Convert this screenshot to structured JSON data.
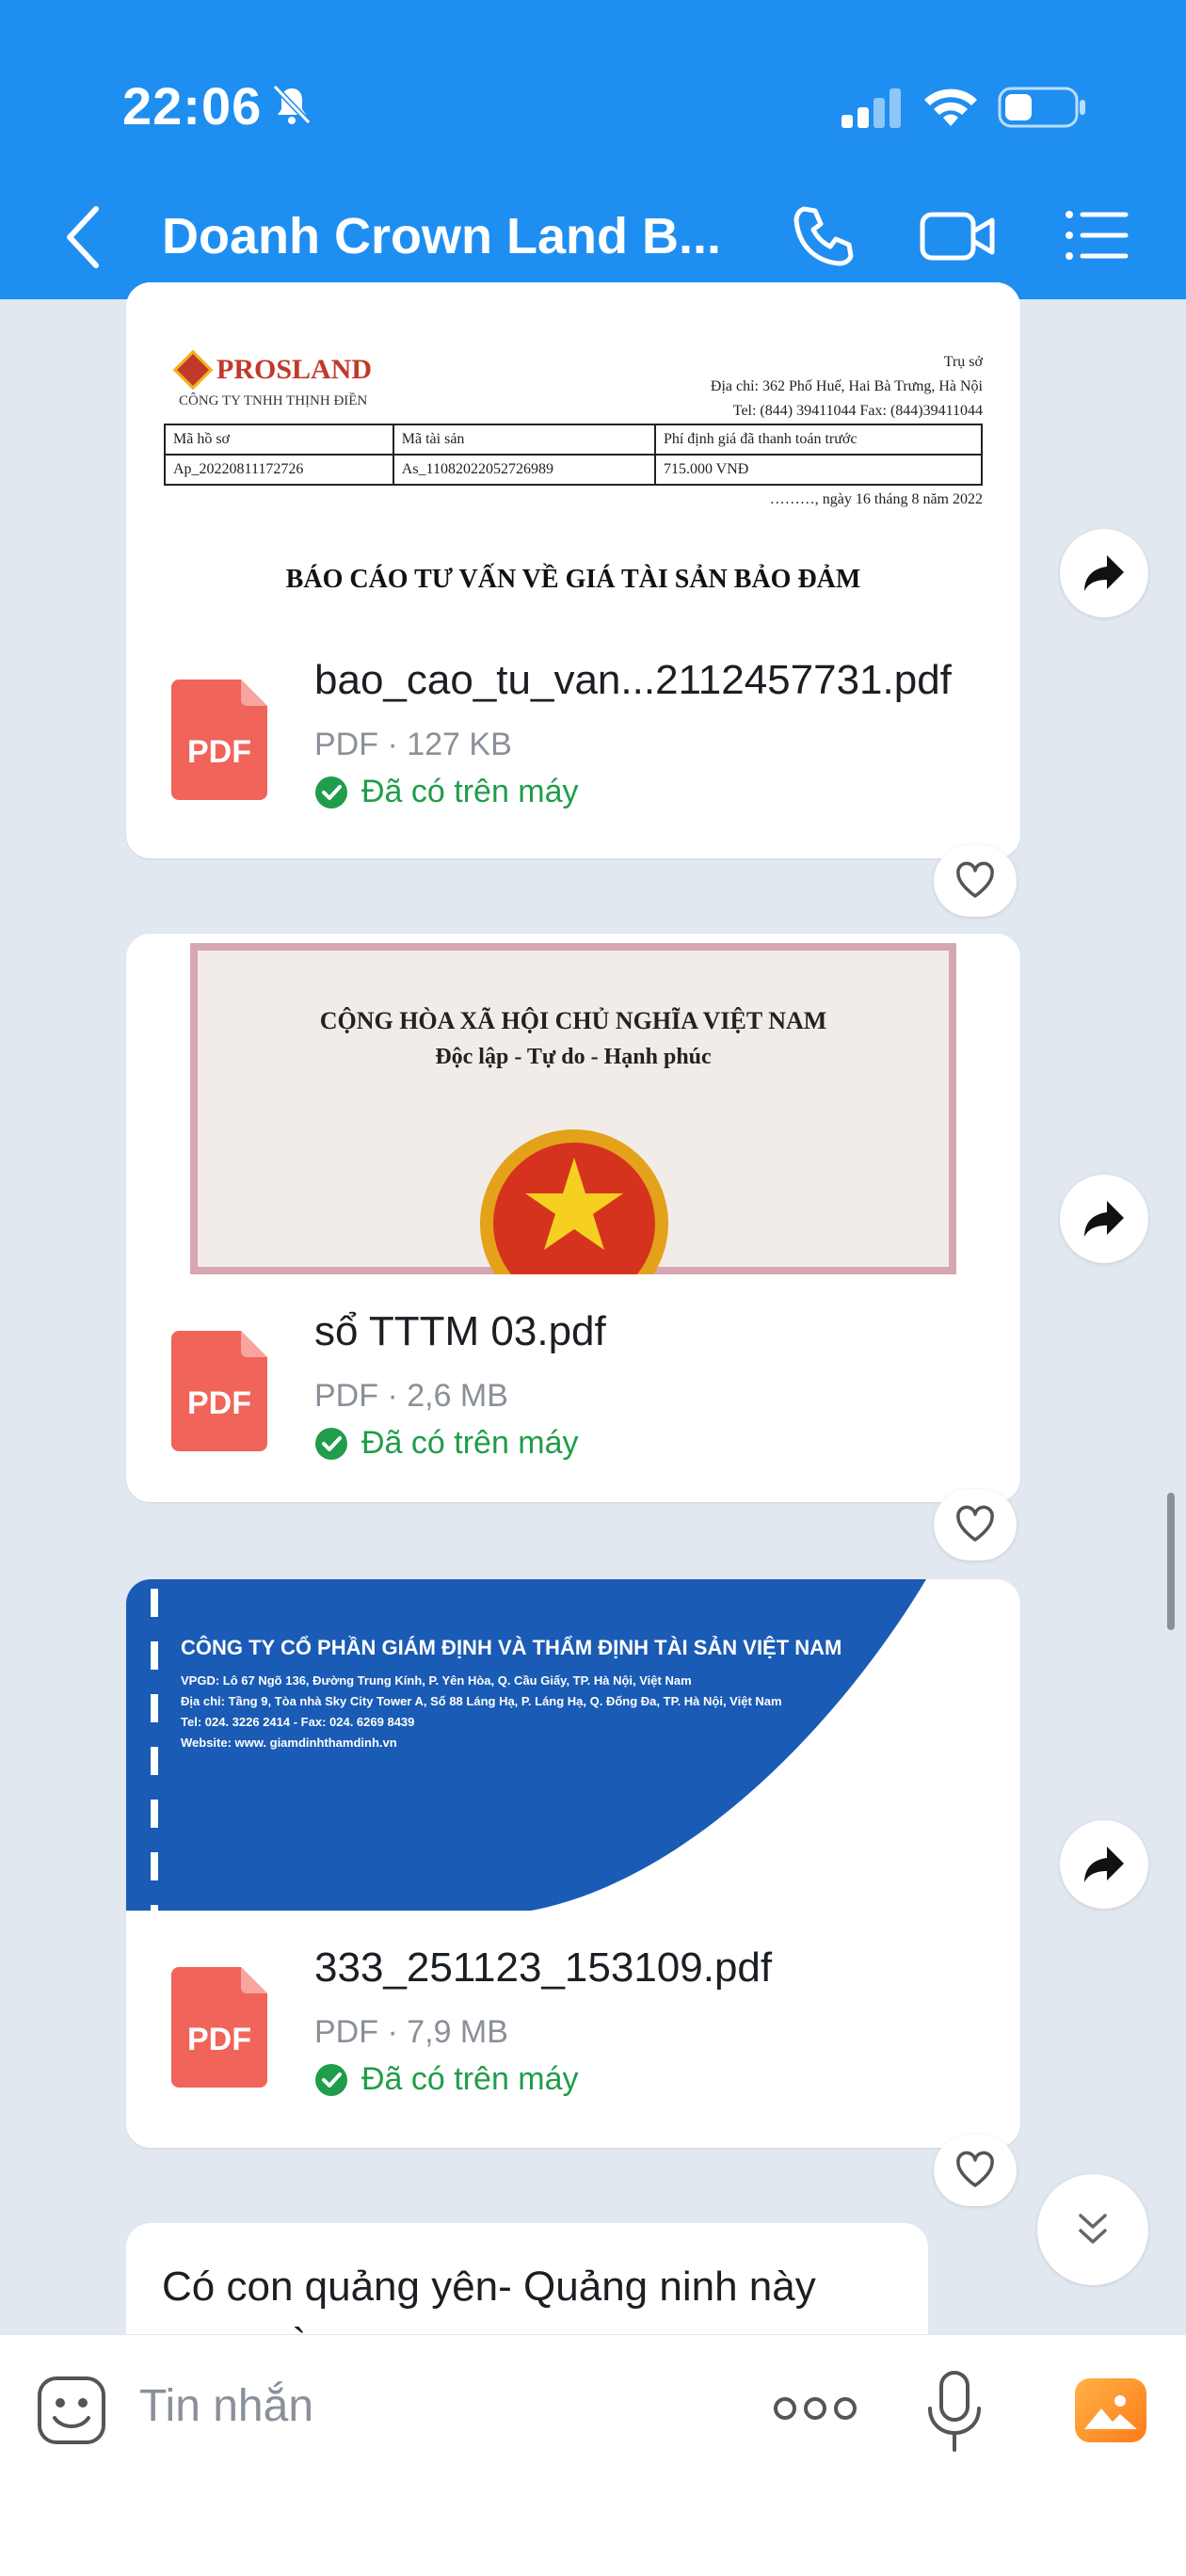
{
  "status_bar": {
    "time": "22:06"
  },
  "header": {
    "title": "Doanh Crown Land B..."
  },
  "files": [
    {
      "name": "bao_cao_tu_van...2112457731.pdf",
      "meta": "PDF · 127 KB",
      "status": "Đã có trên máy",
      "preview": {
        "logo": "PROSLAND",
        "company": "CÔNG TY TNHH THỊNH ĐIỀN",
        "hq_lines": [
          "Trụ sở",
          "Địa chỉ: 362 Phố Huế, Hai Bà Trưng, Hà Nội",
          "Tel: (844) 39411044    Fax: (844)39411044"
        ],
        "table_headers": [
          "Mã hồ sơ",
          "Mã tài sản",
          "Phí định giá đã thanh toán trước"
        ],
        "table_values": [
          "Ap_20220811172726",
          "As_11082022052726989",
          "715.000 VNĐ"
        ],
        "date": "………, ngày 16 tháng 8 năm 2022",
        "title": "BÁO CÁO TƯ VẤN VỀ GIÁ TÀI SẢN BẢO ĐẢM"
      }
    },
    {
      "name": "sổ TTTM 03.pdf",
      "meta": "PDF · 2,6 MB",
      "status": "Đã có trên máy",
      "preview": {
        "line1": "CỘNG HÒA XÃ HỘI CHỦ NGHĨA VIỆT NAM",
        "line2": "Độc lập - Tự do - Hạnh phúc"
      }
    },
    {
      "name": "333_251123_153109.pdf",
      "meta": "PDF · 7,9 MB",
      "status": "Đã có trên máy",
      "preview": {
        "title": "CÔNG TY CỔ PHẦN GIÁM ĐỊNH VÀ THẨM ĐỊNH TÀI SẢN VIỆT NAM",
        "lines": [
          "VPGD: Lô 67 Ngõ 136, Đường Trung Kính, P. Yên Hòa, Q. Cầu Giấy, TP. Hà Nội, Việt Nam",
          "Địa chỉ: Tầng 9, Tòa nhà Sky City Tower A, Số 88 Láng Hạ, P. Láng Hạ, Q. Đống Đa, TP. Hà Nội, Việt Nam",
          "Tel: 024. 3226 2414 - Fax: 024. 6269 8439",
          "Website: www. giamdinhthamdinh.vn"
        ]
      }
    }
  ],
  "message": {
    "text": "Có con quảng yên- Quảng ninh  này ngon này a"
  },
  "input": {
    "placeholder": "Tin nhắn"
  },
  "colors": {
    "header": "#1f8ef1",
    "pdf": "#f0645a",
    "status_green": "#1f9d4a",
    "background": "#e2e8f0"
  }
}
